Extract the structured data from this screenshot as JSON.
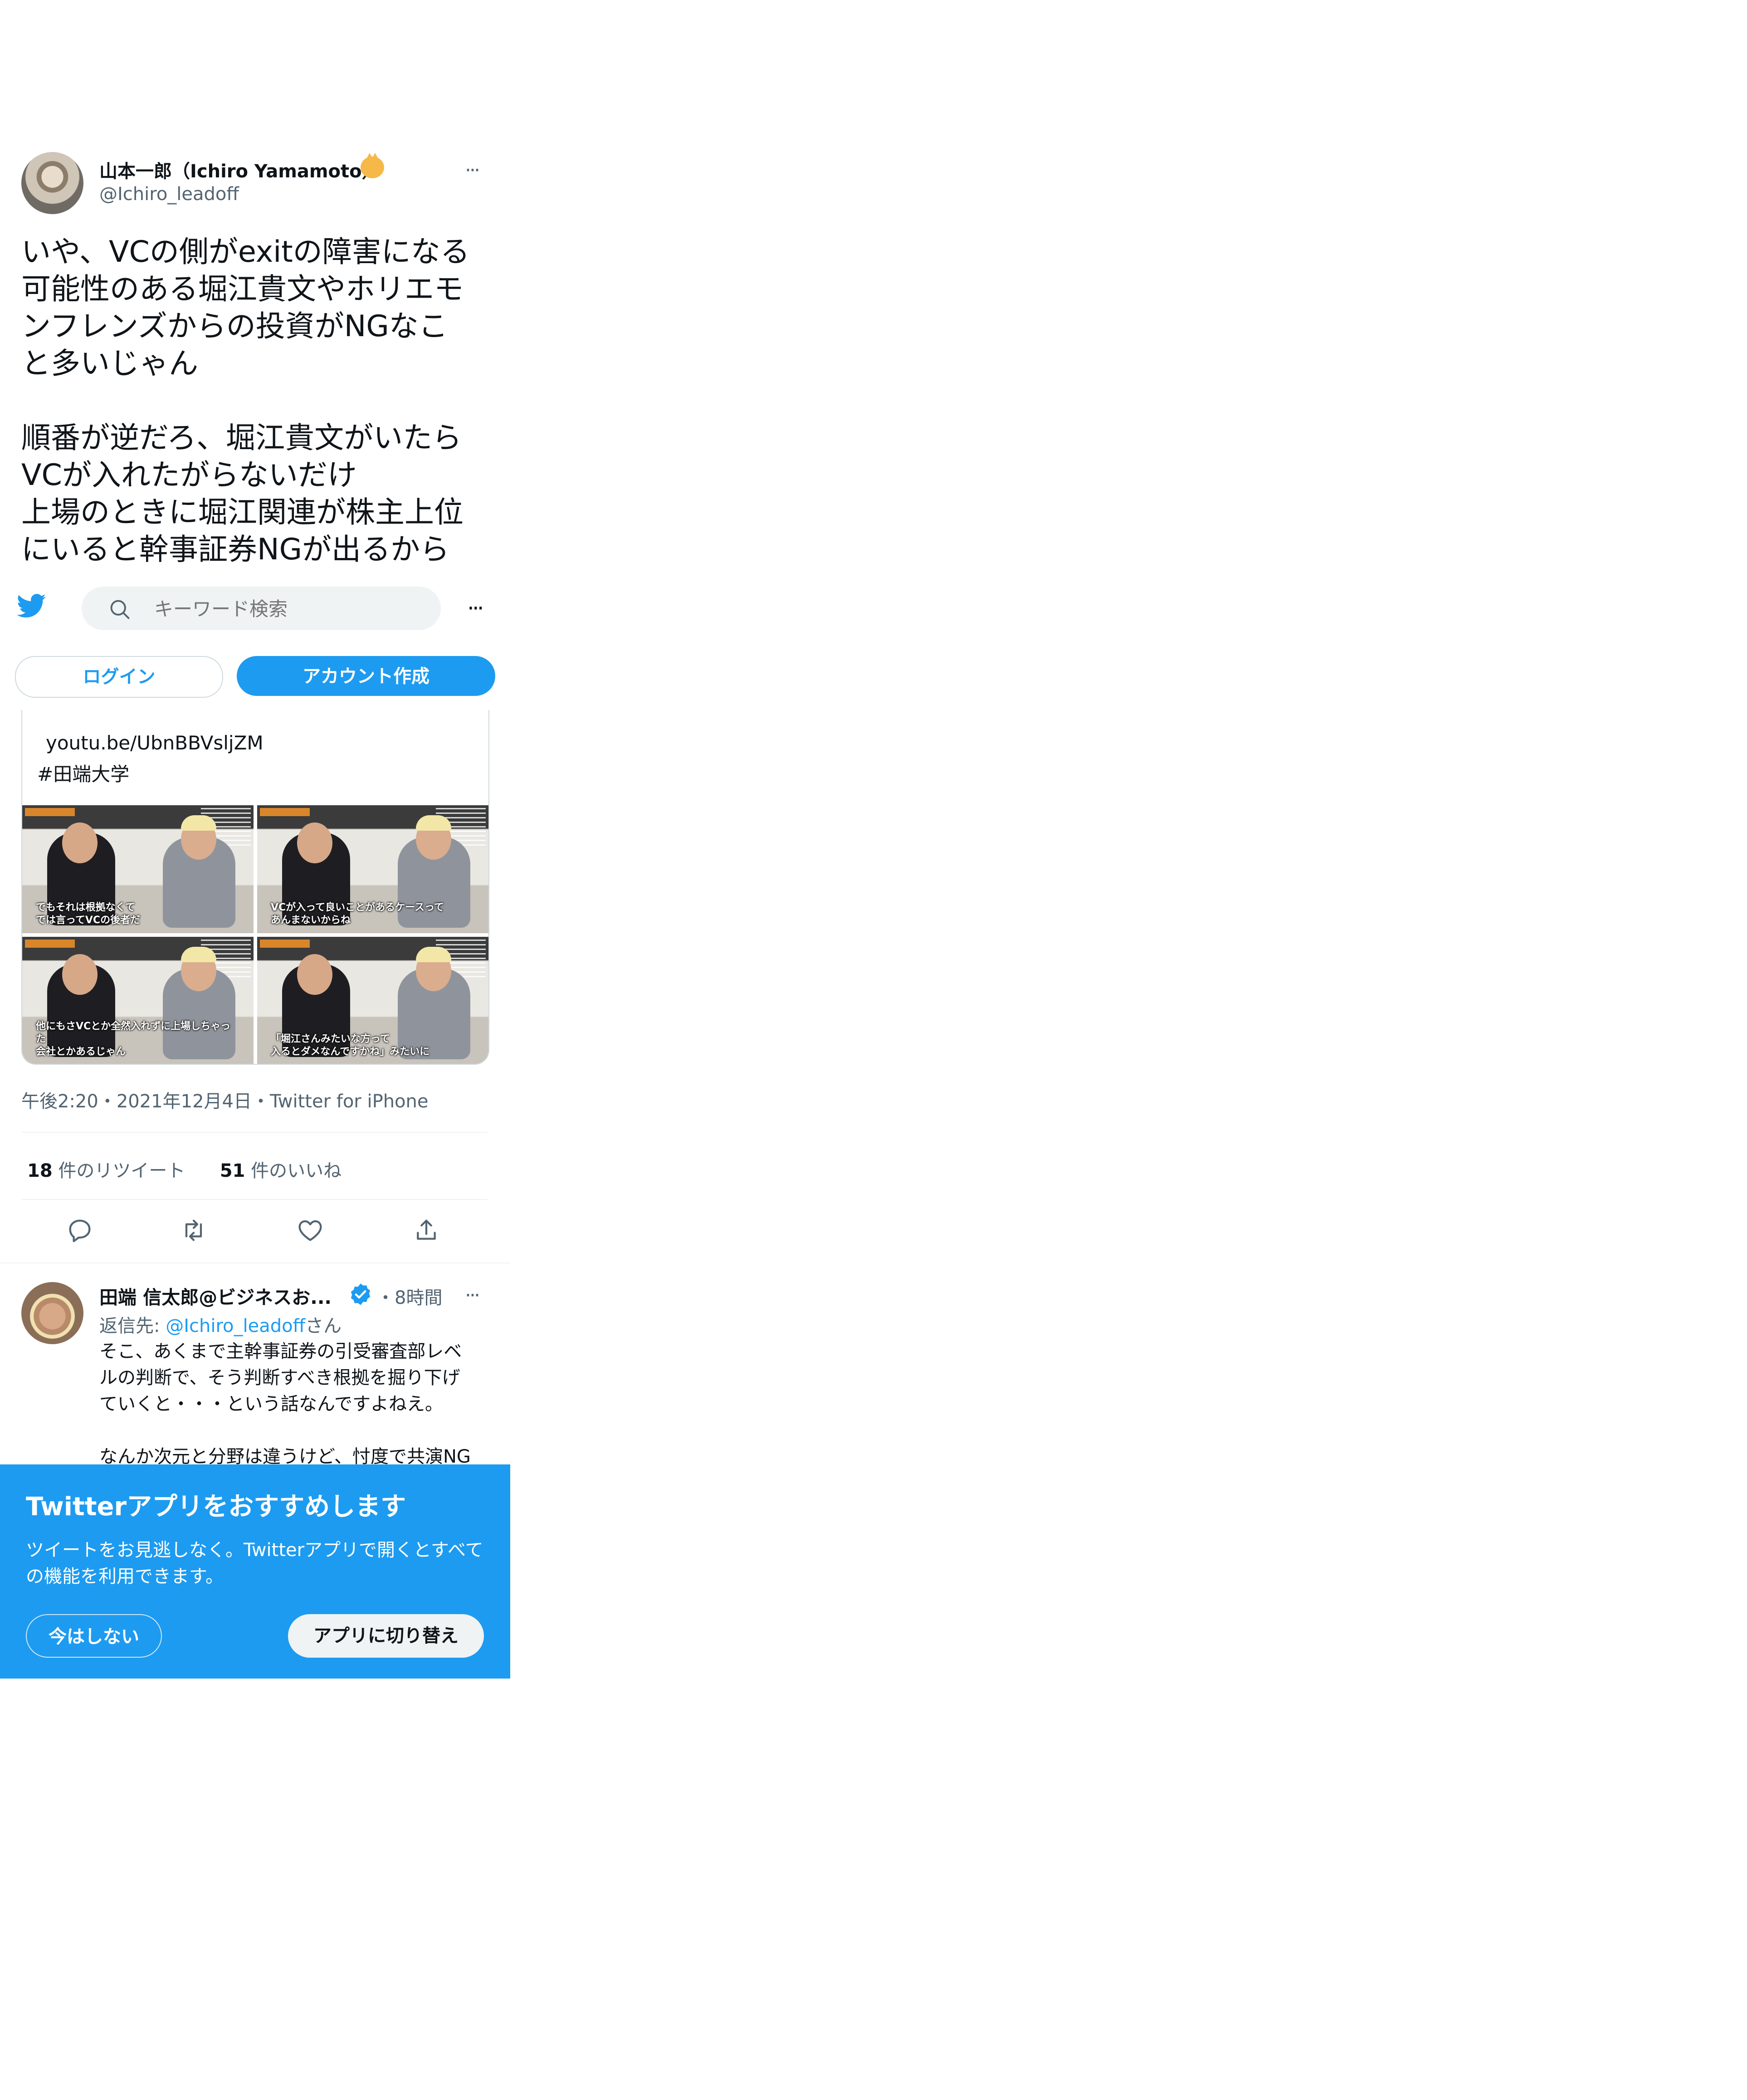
{
  "tweet": {
    "author_name": "山本一郎（Ichiro Yamamoto）",
    "author_handle": "@Ichiro_leadoff",
    "more_label": "···",
    "text": "いや、VCの側がexitの障害になる\n可能性のある堀江貴文やホリエモ\nンフレンズからの投資がNGなこ\nと多いじゃん\n\n順番が逆だろ、堀江貴文がいたら\nVCが入れたがらないだけ\n上場のときに堀江関連が株主上位\nにいると幹事証券NGが出るから",
    "card_link": "youtu.be/UbnBBVsljZM",
    "card_hashtag": "#田端大学",
    "thumb_subs": [
      {
        "line1": "でもそれは根拠なくて",
        "line2": "では言ってVCの後者だ"
      },
      {
        "line1": "VCが入って良いことがあるケースって",
        "line2": "あんまないからね"
      },
      {
        "line1": "他にもさVCとか全然入れずに上場しちゃった",
        "line2": "会社とかあるじゃん"
      },
      {
        "line1": "「堀江さんみたいな方って",
        "line2": "入るとダメなんですかね」みたいに"
      }
    ],
    "meta": "午後2:20・2021年12月4日・Twitter for iPhone",
    "retweets_count": "18",
    "retweets_label": "件のリツイート",
    "likes_count": "51",
    "likes_label": "件のいいね"
  },
  "header": {
    "search_placeholder": "キーワード検索",
    "more_label": "···",
    "login_label": "ログイン",
    "signup_label": "アカウント作成"
  },
  "reply": {
    "author_name": "田端 信太郎@ビジネスお...",
    "time": "・8時間",
    "more_label": "···",
    "reply_prefix": "返信先: ",
    "reply_mention": "@Ichiro_leadoff",
    "reply_suffix": "さん",
    "text": "そこ、あくまで主幹事証券の引受審査部レベ\nルの判断で、そう判断すべき根拠を掘り下げ\nていくと・・・という話なんですよねえ。\n\nなんか次元と分野は違うけど、忖度で共演NG"
  },
  "banner": {
    "title": "Twitterアプリをおすすめします",
    "description": "ツイートをお見逃しなく。Twitterアプリで開くとすべての機能を利用できます。",
    "not_now_label": "今はしない",
    "switch_label": "アプリに切り替え"
  },
  "colors": {
    "accent": "#1d9bf0",
    "text": "#0f1419",
    "secondary": "#536471"
  },
  "icons": [
    "twitter-bird-icon",
    "search-icon",
    "reply-icon",
    "retweet-icon",
    "like-icon",
    "share-icon",
    "verified-badge-icon"
  ]
}
